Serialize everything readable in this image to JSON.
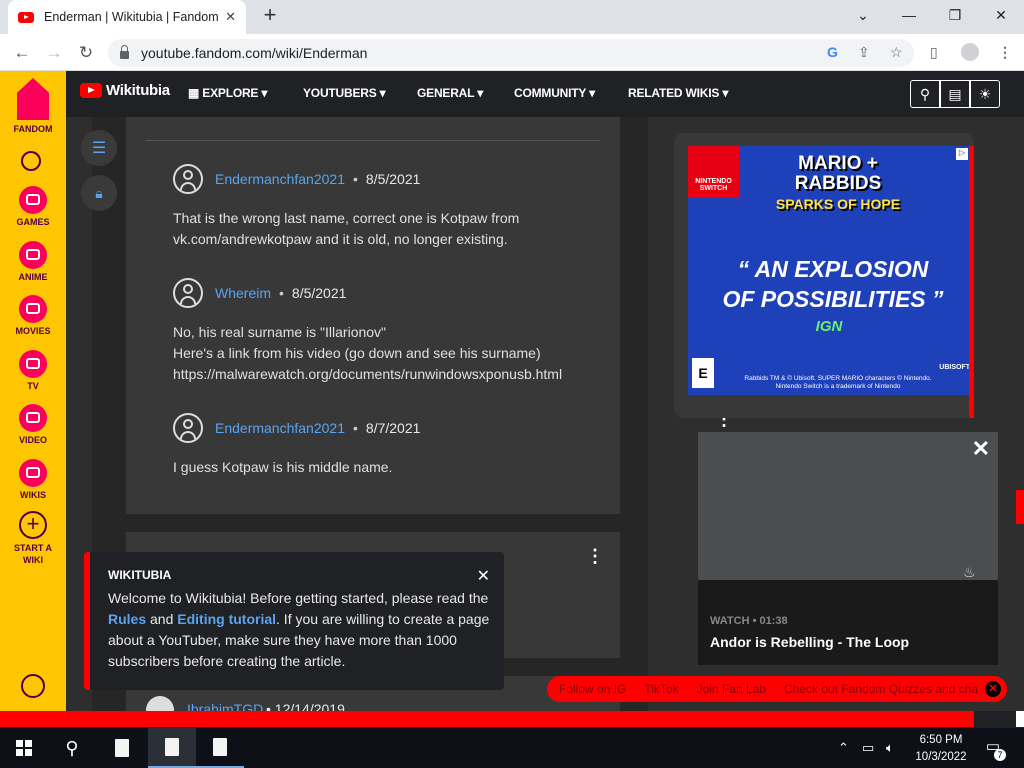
{
  "browser": {
    "tab_title": "Enderman | Wikitubia | Fandom",
    "tab_close": "✕",
    "new_tab": "+",
    "url": "youtube.fandom.com/wiki/Enderman",
    "window_controls": [
      "⌄",
      "—",
      "❐",
      "✕"
    ]
  },
  "fandom_sidebar": {
    "brand": "FANDOM",
    "items": [
      {
        "label": "GAMES",
        "icon": "games-icon"
      },
      {
        "label": "ANIME",
        "icon": "anime-icon"
      },
      {
        "label": "MOVIES",
        "icon": "movies-icon"
      },
      {
        "label": "TV",
        "icon": "tv-icon"
      },
      {
        "label": "VIDEO",
        "icon": "video-icon"
      },
      {
        "label": "WIKIS",
        "icon": "wikis-icon"
      },
      {
        "label": "START A WIKI",
        "icon": "plus-icon"
      }
    ]
  },
  "header": {
    "wiki_name": "Wikitubia",
    "nav": [
      "EXPLORE",
      "YOUTUBERS",
      "GENERAL",
      "COMMUNITY",
      "RELATED WIKIS"
    ]
  },
  "comments": [
    {
      "user": "Endermanchfan2021",
      "date": "8/5/2021",
      "body": "That is the wrong last name, correct one is Kotpaw from vk.com/andrewkotpaw and it is old, no longer existing."
    },
    {
      "user": "Whereim",
      "date": "8/5/2021",
      "body_lines": [
        "No, his real surname is \"Illarionov\"",
        "Here's a link from his video (go down and see his surname)",
        "https://malwarewatch.org/documents/runwindowsxponusb.html"
      ]
    },
    {
      "user": "Endermanchfan2021",
      "date": "8/7/2021",
      "body": "I guess Kotpaw is his middle name."
    }
  ],
  "next_comment": {
    "user": "IbrahimTGD",
    "date": "12/14/2019"
  },
  "banner": {
    "title": "WIKITUBIA",
    "text_1": "Welcome to Wikitubia! Before getting started, please read the ",
    "link_rules": "Rules",
    "text_2": " and ",
    "link_tutorial": "Editing tutorial",
    "text_3": ". If you are willing to create a page about a YouTuber, make sure they have more than 1000 subscribers before creating the article."
  },
  "ad": {
    "switch_label": "NINTENDO SWITCH",
    "title_1": "MARIO + RABBIDS",
    "title_2": "SPARKS OF HOPE",
    "quote_1": "“ AN EXPLOSION",
    "quote_2": "OF POSSIBILITIES ”",
    "source": "IGN",
    "fine_print": "Rabbids TM & © Ubisoft. SUPER MARIO characters © Nintendo. Nintendo Switch is a trademark of Nintendo",
    "rating": "E",
    "publisher": "UBISOFT"
  },
  "video": {
    "meta": "WATCH • 01:38",
    "title": "Andor is Rebelling - The Loop"
  },
  "pill_links": [
    "Follow on IG",
    "TikTok",
    "Join Fan Lab",
    "Check out Fandom Quizzes and cha"
  ],
  "taskbar": {
    "time": "6:50 PM",
    "date": "10/3/2022",
    "notifications": "7"
  }
}
